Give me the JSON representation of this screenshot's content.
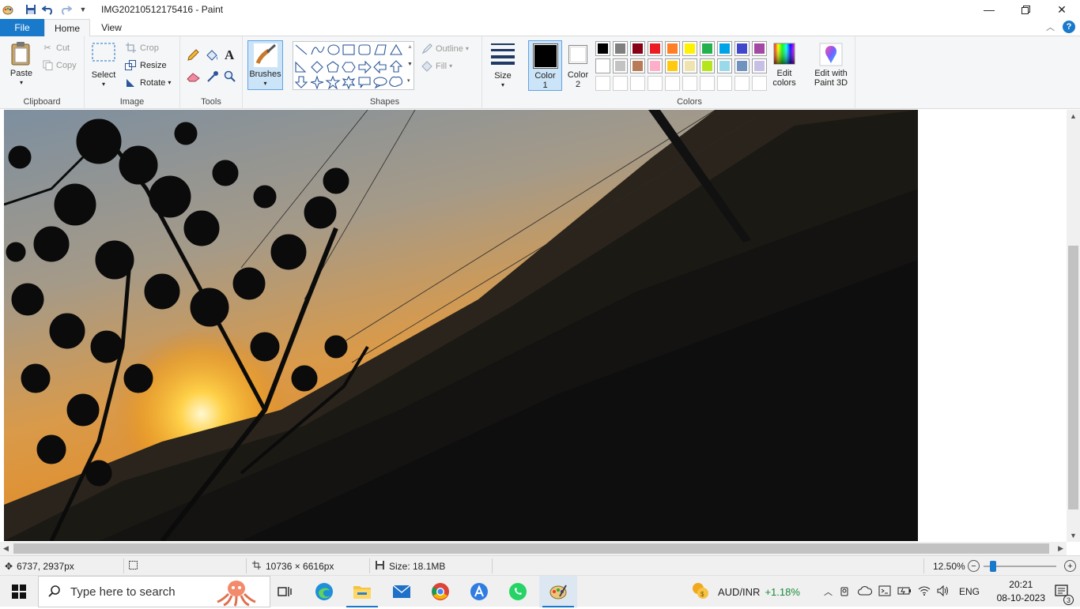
{
  "window": {
    "title": "IMG20210512175416 - Paint"
  },
  "tabs": {
    "file": "File",
    "home": "Home",
    "view": "View"
  },
  "ribbon": {
    "clipboard": {
      "label": "Clipboard",
      "paste": "Paste",
      "cut": "Cut",
      "copy": "Copy"
    },
    "image": {
      "label": "Image",
      "select": "Select",
      "crop": "Crop",
      "resize": "Resize",
      "rotate": "Rotate"
    },
    "tools": {
      "label": "Tools",
      "text_glyph": "A"
    },
    "brushes": {
      "label": "Brushes"
    },
    "shapes": {
      "label": "Shapes",
      "outline": "Outline",
      "fill": "Fill"
    },
    "size": {
      "label": "Size"
    },
    "colors": {
      "label": "Colors",
      "color1_label": "Color",
      "color1_num": "1",
      "color2_label": "Color",
      "color2_num": "2",
      "edit_colors_1": "Edit",
      "edit_colors_2": "colors",
      "paint3d_1": "Edit with",
      "paint3d_2": "Paint 3D",
      "color1": "#000000",
      "color2": "#ffffff",
      "palette_row1": [
        "#000000",
        "#7f7f7f",
        "#880015",
        "#ed1c24",
        "#ff7f27",
        "#fff200",
        "#22b14c",
        "#00a2e8",
        "#3f48cc",
        "#a349a4"
      ],
      "palette_row2": [
        "#ffffff",
        "#c3c3c3",
        "#b97a57",
        "#ffaec9",
        "#ffc90e",
        "#efe4b0",
        "#b5e61d",
        "#99d9ea",
        "#7092be",
        "#c8bfe7"
      ]
    }
  },
  "status": {
    "cursor_pos": "6737, 2937px",
    "dimensions": "10736 × 6616px",
    "size": "Size: 18.1MB",
    "zoom": "12.50%",
    "zoom_fraction": 0.1
  },
  "taskbar": {
    "search_placeholder": "Type here to search",
    "ticker": "AUD/INR",
    "ticker_change": "+1.18%",
    "language": "ENG",
    "time": "20:21",
    "date": "08-10-2023",
    "notifications": "3"
  }
}
